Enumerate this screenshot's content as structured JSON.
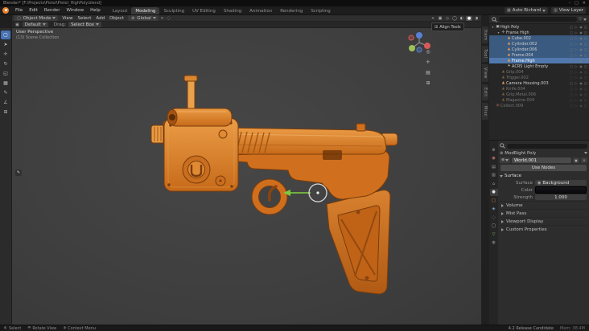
{
  "colors": {
    "accent_orange": "#e8822d",
    "selection_blue": "#4772b3",
    "gun_orange": "#d4762a",
    "viewport_bg": "#3f3f3f"
  },
  "title_bar": {
    "title": "Blender* [F:\\Projects\\Pistol\\Pistol_HighPoly.blend]",
    "minimize": "–",
    "maximize": "□",
    "close": "✕"
  },
  "menu_bar": {
    "menus": [
      "File",
      "Edit",
      "Render",
      "Window",
      "Help"
    ],
    "tabs": [
      {
        "label": "Layout"
      },
      {
        "label": "Modeling",
        "active": true
      },
      {
        "label": "Sculpting"
      },
      {
        "label": "UV Editing"
      },
      {
        "label": "Shading"
      },
      {
        "label": "Animation"
      },
      {
        "label": "Rendering"
      },
      {
        "label": "Scripting"
      }
    ],
    "scene": {
      "icon": "▦",
      "label": "Auto Richard"
    },
    "view_layer": {
      "icon": "▥",
      "label": "View Layer"
    }
  },
  "viewport_header": {
    "mode_icon": "▢",
    "mode_label": "Object Mode",
    "menus": [
      "View",
      "Select",
      "Add",
      "Object"
    ],
    "orientation_icon": "⊕",
    "orientation_label": "Global",
    "snap_icon": "∩",
    "proportional_icon": "◌",
    "right_icons": [
      {
        "glyph": "⌖"
      },
      {
        "glyph": "▣"
      },
      {
        "glyph": "◇"
      },
      {
        "glyph": "◯"
      },
      {
        "glyph": "◐"
      },
      {
        "glyph": "●",
        "active": true
      },
      {
        "glyph": "◑"
      }
    ]
  },
  "tool_settings": {
    "preset_icon": "▣",
    "preset_label": "Default",
    "drag_label": "Drag:",
    "drag_value": "Select Box"
  },
  "toolbar": {
    "tools": [
      {
        "glyph": "▢",
        "name": "select-box",
        "active": true
      },
      {
        "glyph": "➤",
        "name": "cursor"
      },
      {
        "glyph": "✛",
        "name": "move"
      },
      {
        "glyph": "↻",
        "name": "rotate"
      },
      {
        "glyph": "◱",
        "name": "scale"
      },
      {
        "glyph": "▦",
        "name": "transform"
      },
      {
        "glyph": "✎",
        "name": "annotate"
      },
      {
        "glyph": "∠",
        "name": "measure"
      },
      {
        "glyph": "⊞",
        "name": "add-cube"
      }
    ]
  },
  "viewport": {
    "view_label": "User Perspective",
    "collection_label": "(13) Scene Collection",
    "align_panel_icon": "⊞",
    "align_panel_label": "Align Tools",
    "nav_icons": [
      {
        "glyph": "◎",
        "name": "zoom"
      },
      {
        "glyph": "✛",
        "name": "pan"
      },
      {
        "glyph": "▤",
        "name": "camera-view"
      },
      {
        "glyph": "⊞",
        "name": "toggle-ortho"
      }
    ],
    "note_icon": "✎"
  },
  "sidebar_tabs": [
    "Item",
    "Tool",
    "View",
    "Edit",
    "Misc"
  ],
  "outliner": {
    "filter_icon": "▽",
    "toggle_icons": {
      "checkbox": "□",
      "pointer": "▷",
      "eye": "◉",
      "camera": "◫"
    },
    "rows": [
      {
        "label": "High Poly",
        "depth": 0,
        "arrow": "▾",
        "glyph": "▣",
        "icon_class": "ico-col"
      },
      {
        "label": "Frame High",
        "depth": 1,
        "arrow": "▾",
        "glyph": "✛",
        "icon_class": "ico-empty"
      },
      {
        "label": "Cube.002",
        "depth": 2,
        "glyph": "▲",
        "icon_class": "ico-mesh",
        "selected": true
      },
      {
        "label": "Cylinder.002",
        "depth": 2,
        "glyph": "▲",
        "icon_class": "ico-mesh",
        "selected": true
      },
      {
        "label": "Cylinder.006",
        "depth": 2,
        "glyph": "▲",
        "icon_class": "ico-mesh",
        "selected": true
      },
      {
        "label": "Frame.004",
        "depth": 2,
        "glyph": "▲",
        "icon_class": "ico-mesh",
        "selected": true
      },
      {
        "label": "Frame.High",
        "depth": 2,
        "glyph": "▲",
        "icon_class": "ico-mesh",
        "active": true
      },
      {
        "label": "ACR5 Light Empty",
        "depth": 2,
        "glyph": "☀",
        "icon_class": "ico-light"
      },
      {
        "label": "Grip.004",
        "depth": 1,
        "glyph": "▲",
        "icon_class": "ico-mesh",
        "dim": true
      },
      {
        "label": "Trigger.002",
        "depth": 1,
        "glyph": "▲",
        "icon_class": "ico-mesh",
        "dim": true
      },
      {
        "label": "Camera Housing.003",
        "depth": 1,
        "glyph": "▲",
        "icon_class": "ico-mesh"
      },
      {
        "label": "Knife.004",
        "depth": 1,
        "glyph": "▲",
        "icon_class": "ico-mesh",
        "dim": true
      },
      {
        "label": "Grip.Metal.006",
        "depth": 1,
        "glyph": "▲",
        "icon_class": "ico-mesh",
        "dim": true
      },
      {
        "label": "Magazine.004",
        "depth": 1,
        "glyph": "▲",
        "icon_class": "ico-mesh",
        "dim": true
      },
      {
        "label": "Collect.009",
        "depth": 0,
        "glyph": "▣",
        "icon_class": "ico-red",
        "dim": true
      }
    ]
  },
  "properties": {
    "tabs": [
      {
        "glyph": "⚙",
        "name": "tool"
      },
      {
        "glyph": "◉",
        "name": "render",
        "cls": "c-red"
      },
      {
        "glyph": "▤",
        "name": "output"
      },
      {
        "glyph": "▥",
        "name": "view-layer"
      },
      {
        "glyph": "⌂",
        "name": "scene"
      },
      {
        "glyph": "●",
        "name": "world",
        "cls": "c-orange",
        "active": true
      },
      {
        "glyph": "□",
        "name": "object",
        "cls": "c-orange"
      },
      {
        "glyph": "◈",
        "name": "modifiers",
        "cls": "c-blue"
      },
      {
        "glyph": "◌",
        "name": "particles"
      },
      {
        "glyph": "◯",
        "name": "physics"
      },
      {
        "glyph": "▽",
        "name": "data",
        "cls": "c-green"
      },
      {
        "glyph": "◍",
        "name": "material"
      }
    ],
    "breadcrumb": {
      "icon": "⊕",
      "label": "ModRight Poly"
    },
    "id_block": {
      "type_icon": "⊕",
      "name": "World.001",
      "shield_icon": "▣",
      "unlink_icon": "✕"
    },
    "use_nodes_label": "Use Nodes",
    "surface": {
      "header": "Surface",
      "surface_label": "Surface",
      "surface_value_icon": "◉",
      "surface_value": "Background",
      "color_label": "Color",
      "strength_label": "Strength",
      "strength_value": "1.000"
    },
    "sections": [
      "Volume",
      "Mist Pass",
      "Viewport Display",
      "Custom Properties"
    ]
  },
  "status_bar": {
    "hints": [
      {
        "glyph": "◐",
        "label": "Select"
      },
      {
        "glyph": "◓",
        "label": "Rotate View"
      },
      {
        "glyph": "◑",
        "label": "Context Menu"
      }
    ],
    "version": "4.2 Release Candidate",
    "stats": "Mem: 38.4M"
  }
}
